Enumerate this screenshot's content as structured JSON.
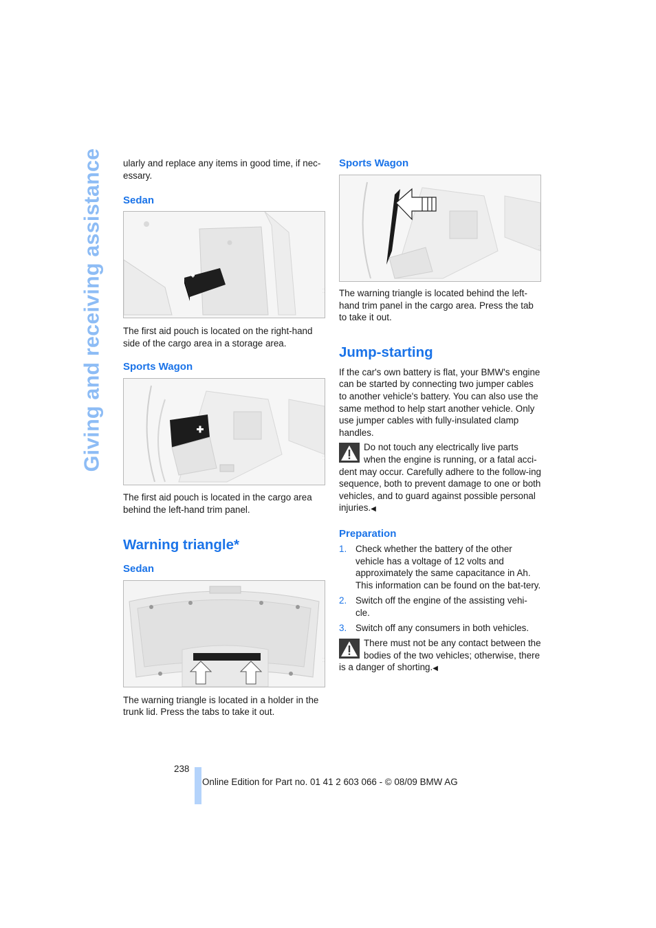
{
  "side_title": "Giving and receiving assistance",
  "left_column": {
    "intro_text": "ularly and replace any items in good time, if nec-essary.",
    "first_aid_sedan": {
      "heading": "Sedan",
      "caption": "The first aid pouch is located on the right-hand side of the cargo area in a storage area."
    },
    "first_aid_wagon": {
      "heading": "Sports Wagon",
      "caption": "The first aid pouch is located in the cargo area behind the left-hand trim panel."
    },
    "warning_triangle": {
      "heading": "Warning triangle*",
      "sedan_heading": "Sedan",
      "sedan_caption": "The warning triangle is located in a holder in the trunk lid. Press the tabs to take it out."
    }
  },
  "right_column": {
    "wagon_heading": "Sports Wagon",
    "wagon_caption": "The warning triangle is located behind the left-hand trim panel in the cargo area. Press the tab to take it out.",
    "jump_starting": {
      "heading": "Jump-starting",
      "intro": "If the car's own battery is flat, your BMW's engine can be started by connecting two jumper cables to another vehicle's battery. You can also use the same method to help start another vehicle. Only use jumper cables with fully-insulated clamp handles.",
      "warning_1": "Do not touch any electrically live parts when the engine is running, or a fatal acci-dent may occur. Carefully adhere to the follow-ing sequence, both to prevent damage to one or both vehicles, and to guard against possible personal injuries.",
      "preparation_heading": "Preparation",
      "steps": [
        {
          "num": "1.",
          "text": "Check whether the battery of the other vehicle has a voltage of 12 volts and approximately the same capacitance in Ah. This information can be found on the bat-tery."
        },
        {
          "num": "2.",
          "text": "Switch off the engine of the assisting vehi-cle."
        },
        {
          "num": "3.",
          "text": "Switch off any consumers in both vehicles."
        }
      ],
      "warning_2": "There must not be any contact between the bodies of the two vehicles; otherwise, there is a danger of shorting.",
      "end_mark": "◀"
    }
  },
  "footer": {
    "page_number": "238",
    "edition_text": "Online Edition for Part no. 01 41 2 603 066 - © 08/09 BMW AG"
  },
  "colors": {
    "heading_blue": "#1a73e8",
    "side_title_blue": "#8dbcf5",
    "footer_bar": "#b4d3fb"
  }
}
